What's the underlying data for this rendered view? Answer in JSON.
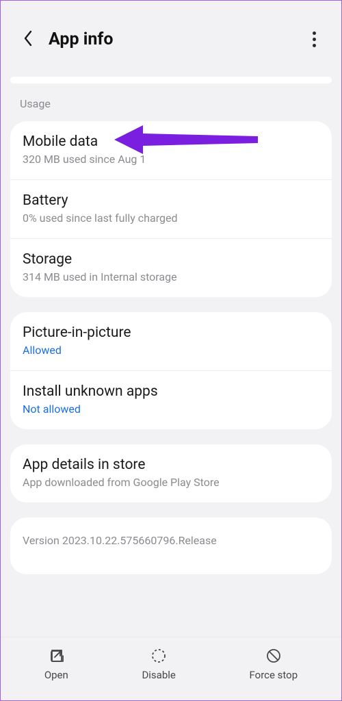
{
  "header": {
    "title": "App info"
  },
  "section_label": "Usage",
  "usage": {
    "mobile_data": {
      "title": "Mobile data",
      "sub": "320 MB used since Aug 1"
    },
    "battery": {
      "title": "Battery",
      "sub": "0% used since last fully charged"
    },
    "storage": {
      "title": "Storage",
      "sub": "314 MB used in Internal storage"
    }
  },
  "permissions": {
    "pip": {
      "title": "Picture-in-picture",
      "sub": "Allowed"
    },
    "unknown": {
      "title": "Install unknown apps",
      "sub": "Not allowed"
    }
  },
  "store": {
    "title": "App details in store",
    "sub": "App downloaded from Google Play Store"
  },
  "version_text": "Version 2023.10.22.575660796.Release",
  "footer": {
    "open": "Open",
    "disable": "Disable",
    "force_stop": "Force stop"
  },
  "annotation": {
    "arrow_color": "#7a1fe0"
  }
}
